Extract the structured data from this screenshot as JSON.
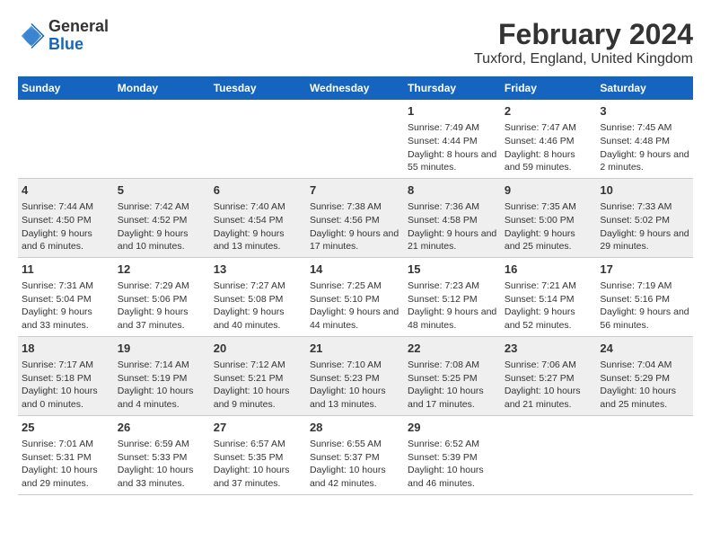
{
  "logo": {
    "general": "General",
    "blue": "Blue"
  },
  "title": "February 2024",
  "subtitle": "Tuxford, England, United Kingdom",
  "days_of_week": [
    "Sunday",
    "Monday",
    "Tuesday",
    "Wednesday",
    "Thursday",
    "Friday",
    "Saturday"
  ],
  "weeks": [
    [
      {
        "day": "",
        "info": ""
      },
      {
        "day": "",
        "info": ""
      },
      {
        "day": "",
        "info": ""
      },
      {
        "day": "",
        "info": ""
      },
      {
        "day": "1",
        "info": "Sunrise: 7:49 AM\nSunset: 4:44 PM\nDaylight: 8 hours and 55 minutes."
      },
      {
        "day": "2",
        "info": "Sunrise: 7:47 AM\nSunset: 4:46 PM\nDaylight: 8 hours and 59 minutes."
      },
      {
        "day": "3",
        "info": "Sunrise: 7:45 AM\nSunset: 4:48 PM\nDaylight: 9 hours and 2 minutes."
      }
    ],
    [
      {
        "day": "4",
        "info": "Sunrise: 7:44 AM\nSunset: 4:50 PM\nDaylight: 9 hours and 6 minutes."
      },
      {
        "day": "5",
        "info": "Sunrise: 7:42 AM\nSunset: 4:52 PM\nDaylight: 9 hours and 10 minutes."
      },
      {
        "day": "6",
        "info": "Sunrise: 7:40 AM\nSunset: 4:54 PM\nDaylight: 9 hours and 13 minutes."
      },
      {
        "day": "7",
        "info": "Sunrise: 7:38 AM\nSunset: 4:56 PM\nDaylight: 9 hours and 17 minutes."
      },
      {
        "day": "8",
        "info": "Sunrise: 7:36 AM\nSunset: 4:58 PM\nDaylight: 9 hours and 21 minutes."
      },
      {
        "day": "9",
        "info": "Sunrise: 7:35 AM\nSunset: 5:00 PM\nDaylight: 9 hours and 25 minutes."
      },
      {
        "day": "10",
        "info": "Sunrise: 7:33 AM\nSunset: 5:02 PM\nDaylight: 9 hours and 29 minutes."
      }
    ],
    [
      {
        "day": "11",
        "info": "Sunrise: 7:31 AM\nSunset: 5:04 PM\nDaylight: 9 hours and 33 minutes."
      },
      {
        "day": "12",
        "info": "Sunrise: 7:29 AM\nSunset: 5:06 PM\nDaylight: 9 hours and 37 minutes."
      },
      {
        "day": "13",
        "info": "Sunrise: 7:27 AM\nSunset: 5:08 PM\nDaylight: 9 hours and 40 minutes."
      },
      {
        "day": "14",
        "info": "Sunrise: 7:25 AM\nSunset: 5:10 PM\nDaylight: 9 hours and 44 minutes."
      },
      {
        "day": "15",
        "info": "Sunrise: 7:23 AM\nSunset: 5:12 PM\nDaylight: 9 hours and 48 minutes."
      },
      {
        "day": "16",
        "info": "Sunrise: 7:21 AM\nSunset: 5:14 PM\nDaylight: 9 hours and 52 minutes."
      },
      {
        "day": "17",
        "info": "Sunrise: 7:19 AM\nSunset: 5:16 PM\nDaylight: 9 hours and 56 minutes."
      }
    ],
    [
      {
        "day": "18",
        "info": "Sunrise: 7:17 AM\nSunset: 5:18 PM\nDaylight: 10 hours and 0 minutes."
      },
      {
        "day": "19",
        "info": "Sunrise: 7:14 AM\nSunset: 5:19 PM\nDaylight: 10 hours and 4 minutes."
      },
      {
        "day": "20",
        "info": "Sunrise: 7:12 AM\nSunset: 5:21 PM\nDaylight: 10 hours and 9 minutes."
      },
      {
        "day": "21",
        "info": "Sunrise: 7:10 AM\nSunset: 5:23 PM\nDaylight: 10 hours and 13 minutes."
      },
      {
        "day": "22",
        "info": "Sunrise: 7:08 AM\nSunset: 5:25 PM\nDaylight: 10 hours and 17 minutes."
      },
      {
        "day": "23",
        "info": "Sunrise: 7:06 AM\nSunset: 5:27 PM\nDaylight: 10 hours and 21 minutes."
      },
      {
        "day": "24",
        "info": "Sunrise: 7:04 AM\nSunset: 5:29 PM\nDaylight: 10 hours and 25 minutes."
      }
    ],
    [
      {
        "day": "25",
        "info": "Sunrise: 7:01 AM\nSunset: 5:31 PM\nDaylight: 10 hours and 29 minutes."
      },
      {
        "day": "26",
        "info": "Sunrise: 6:59 AM\nSunset: 5:33 PM\nDaylight: 10 hours and 33 minutes."
      },
      {
        "day": "27",
        "info": "Sunrise: 6:57 AM\nSunset: 5:35 PM\nDaylight: 10 hours and 37 minutes."
      },
      {
        "day": "28",
        "info": "Sunrise: 6:55 AM\nSunset: 5:37 PM\nDaylight: 10 hours and 42 minutes."
      },
      {
        "day": "29",
        "info": "Sunrise: 6:52 AM\nSunset: 5:39 PM\nDaylight: 10 hours and 46 minutes."
      },
      {
        "day": "",
        "info": ""
      },
      {
        "day": "",
        "info": ""
      }
    ]
  ]
}
